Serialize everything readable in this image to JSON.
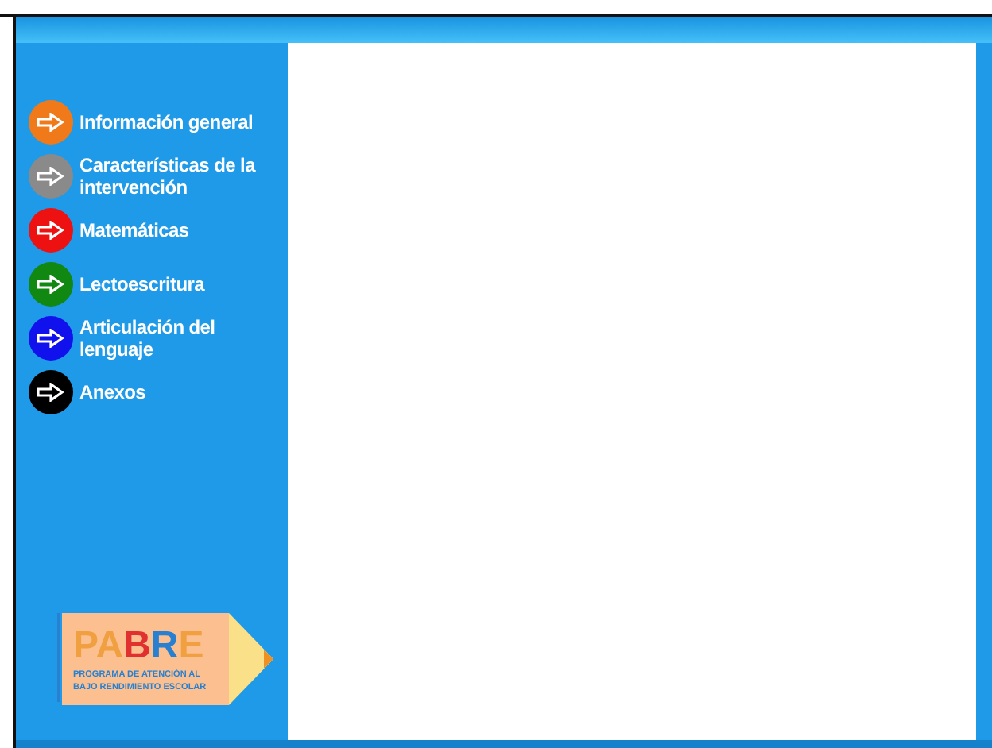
{
  "menu": [
    {
      "label": "Información general",
      "color": "#f07a1a"
    },
    {
      "label": "Características de la intervención",
      "color": "#8a8a8a"
    },
    {
      "label": "Matemáticas",
      "color": "#ee1111"
    },
    {
      "label": "Lectoescritura",
      "color": "#118811"
    },
    {
      "label": "Articulación del lenguaje",
      "color": "#1111ee"
    },
    {
      "label": "Anexos",
      "color": "#000000"
    }
  ],
  "logo": {
    "letters": [
      {
        "text": "P",
        "color": "#f0a040"
      },
      {
        "text": "A",
        "color": "#f0a040"
      },
      {
        "text": "B",
        "color": "#e03030"
      },
      {
        "text": "R",
        "color": "#2a80d0"
      },
      {
        "text": "E",
        "color": "#f0a040"
      }
    ],
    "subtitle": [
      "PROGRAMA DE ATENCIÓN AL",
      "BAJO RENDIMIENTO ESCOLAR"
    ]
  }
}
